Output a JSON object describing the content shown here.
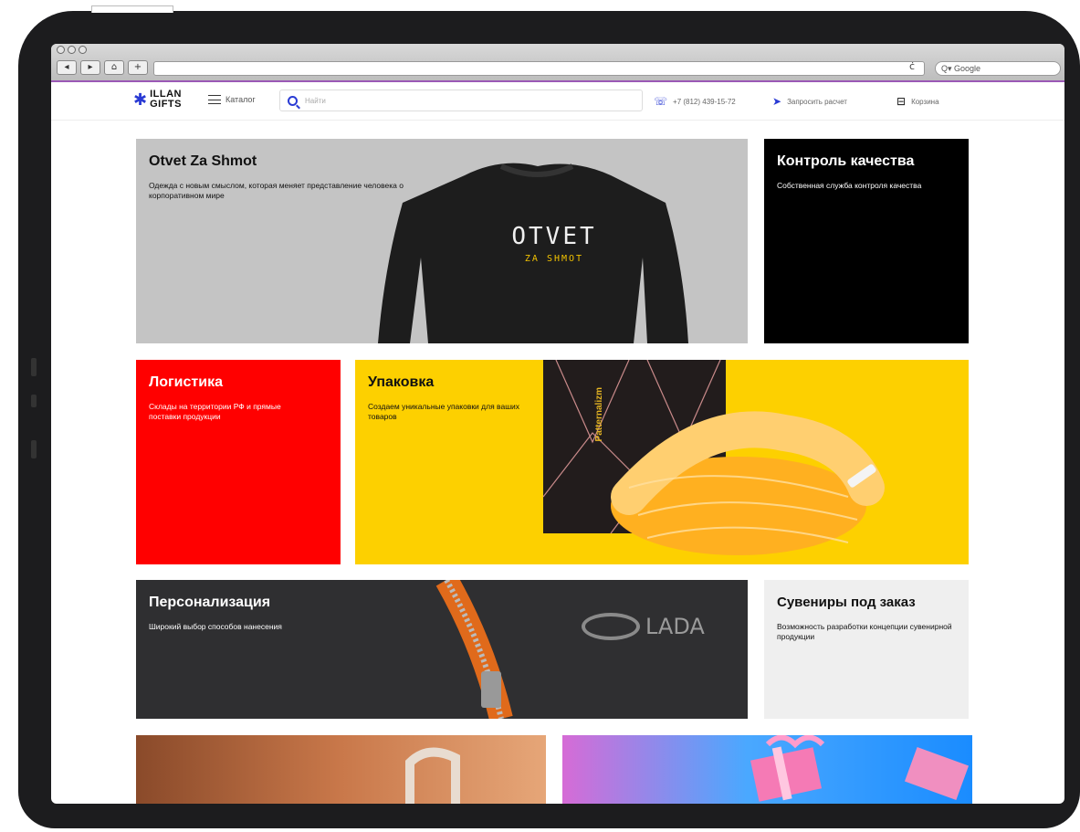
{
  "browser": {
    "back": "◂",
    "forward": "▸",
    "home": "⌂",
    "add": "+",
    "reload": "ċ",
    "search_placeholder": "Q▾ Google"
  },
  "header": {
    "logo_line1": "ILLAN",
    "logo_line2": "GIFTS",
    "catalog": "Каталог",
    "search_placeholder": "Найти",
    "phone": "+7 (812) 439-15-72",
    "request": "Запросить расчет",
    "cart": "Корзина"
  },
  "tiles": {
    "otvet": {
      "title": "Otvet Za Shmot",
      "text": "Одежда с новым смыслом, которая меняет представление человека о корпоративном мире",
      "print_main": "OTVET",
      "print_sub": "ZA SHMOT"
    },
    "control": {
      "title": "Контроль качества",
      "text": "Собственная служба контроля качества"
    },
    "logistics": {
      "title": "Логистика",
      "text": "Склады на территории РФ и прямые поставки продукции"
    },
    "packaging": {
      "title": "Упаковка",
      "text": "Создаем уникальные упаковки для ваших товаров",
      "box_label": "Patternalizm"
    },
    "personal": {
      "title": "Персонализация",
      "text": "Широкий выбор способов нанесения",
      "brand": "LADA"
    },
    "souvenir": {
      "title": "Сувениры под заказ",
      "text": "Возможность разработки концепции сувенирной продукции"
    }
  },
  "colors": {
    "accent": "#2a3bd4",
    "red": "#ff0000",
    "yellow": "#fdd000",
    "black": "#000000",
    "grey": "#c4c4c4"
  }
}
